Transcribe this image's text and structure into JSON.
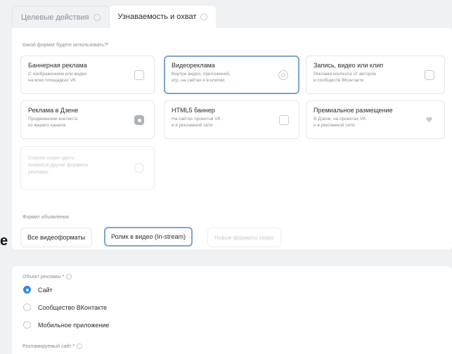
{
  "tabs": [
    {
      "label": "Целевые действия",
      "active": false
    },
    {
      "label": "Узнаваемость и охват",
      "active": true
    }
  ],
  "format_question": "Какой формат будете использовать?",
  "required_mark": "*",
  "formats": [
    {
      "title": "Баннерная реклама",
      "desc": "С изображением или видео\nна всех площадках VK",
      "icon": "image-icon"
    },
    {
      "title": "Видеореклама",
      "desc": "Внутри видео, приложений,\nигр, на сайтах и в клипах",
      "icon": "video-circle-icon",
      "selected": true
    },
    {
      "title": "Запись, видео или клип",
      "desc": "Реклама контента от авторов\nи сообществ ВКонтакте",
      "icon": "vk-icon"
    },
    {
      "title": "Реклама в Дзене",
      "desc": "Продвижение контента\nиз вашего канала",
      "icon": "dzen-icon"
    },
    {
      "title": "HTML5 баннер",
      "desc": "На сайтах проектов VK\nи в рекламной сети",
      "icon": "html5-icon"
    },
    {
      "title": "Премиальное размещение",
      "desc": "В Дзене, на проектах VK\nи в рекламной сети",
      "icon": "diamond-icon"
    },
    {
      "title": "",
      "desc": "Совсем скоро здесь\nпоявятся другие форматы\nрекламы",
      "icon": "clock-icon",
      "disabled": true
    }
  ],
  "ad_format_label": "Формат объявления",
  "ad_formats": [
    {
      "label": "Все видеоформаты"
    },
    {
      "label": "Ролик в видео (In-stream)",
      "selected": true
    },
    {
      "label": "Новые форматы скоро",
      "disabled": true
    }
  ],
  "edge_glyph": "е",
  "ad_object_label": "Объект рекламы",
  "ad_objects": [
    {
      "label": "Сайт",
      "selected": true
    },
    {
      "label": "Сообщество ВКонтакте"
    },
    {
      "label": "Мобильное приложение"
    }
  ],
  "site_label": "Рекламируемый сайт",
  "colors": {
    "accent": "#2688eb",
    "selected_border": "#7aa6cf",
    "required": "#e64646"
  }
}
